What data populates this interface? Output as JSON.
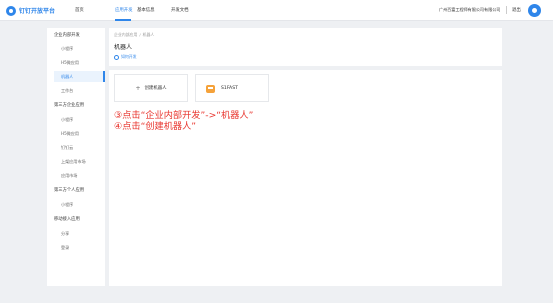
{
  "topbar": {
    "logo_text": "钉钉开放平台",
    "nav": [
      "首页",
      "应用开发",
      "基本信息",
      "开发文档"
    ],
    "company": "广州百富工程师有限公司有限公司",
    "logout": "退出"
  },
  "sidebar": {
    "groups": [
      {
        "label": "企业内部开发",
        "items": [
          "小程序",
          "H5微应用",
          "机器人",
          "工作台"
        ]
      },
      {
        "label": "第三方企业应用",
        "items": [
          "小程序",
          "H5微应用",
          "钉钉云",
          "上架应用市场",
          "应用市场"
        ]
      },
      {
        "label": "第三方个人应用",
        "items": [
          "小程序"
        ]
      },
      {
        "label": "移动接入应用",
        "items": [
          "分享",
          "登录"
        ]
      }
    ],
    "active_item": "机器人"
  },
  "header": {
    "breadcrumb": [
      "企业内部应用",
      "机器人"
    ],
    "title": "机器人",
    "docs_link": "如何开发"
  },
  "main": {
    "create_button": "创建机器人",
    "bot_name": "S1FAST"
  },
  "annotations": {
    "line1": "③点击“企业内部开发”->“机器人”",
    "line2": "④点击“创建机器人”"
  }
}
